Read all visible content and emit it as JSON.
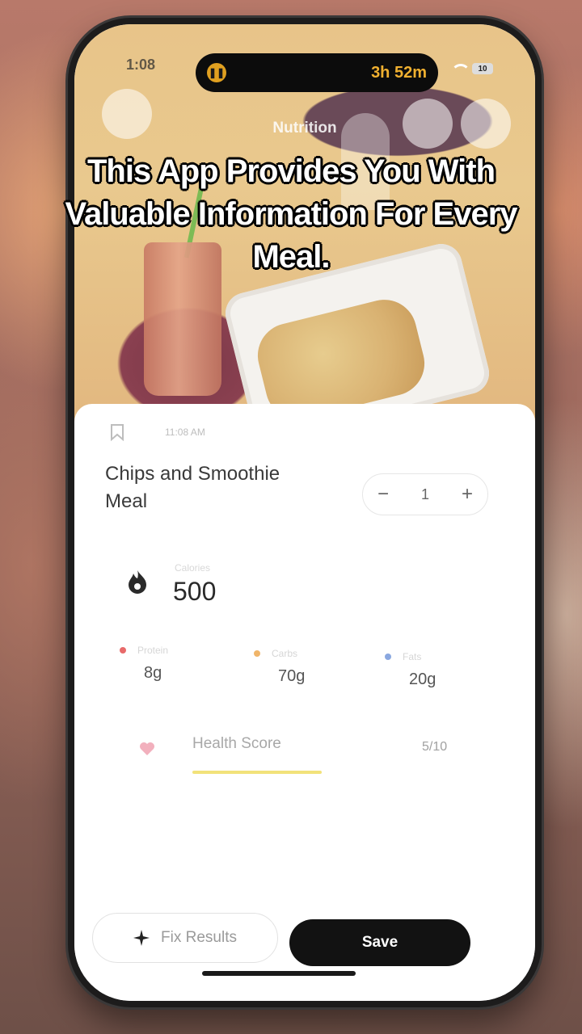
{
  "status_bar": {
    "time": "1:08",
    "island_timer": "3h 52m",
    "battery": "10"
  },
  "header": {
    "title": "Nutrition"
  },
  "caption": "This App Provides You With Valuable Information For Every Meal.",
  "meal": {
    "time": "11:08 AM",
    "name": "Chips and Smoothie Meal",
    "quantity": "1",
    "minus_label": "−",
    "plus_label": "+"
  },
  "calories": {
    "label": "Calories",
    "value": "500"
  },
  "macros": [
    {
      "label": "Protein",
      "value": "8g",
      "color": "#e86a6a"
    },
    {
      "label": "Carbs",
      "value": "70g",
      "color": "#f0b56a"
    },
    {
      "label": "Fats",
      "value": "20g",
      "color": "#8aa8e0"
    }
  ],
  "health_score": {
    "label": "Health Score",
    "value": "5/10",
    "level": 0.5,
    "bar_color": "#f2e27a"
  },
  "actions": {
    "fix_label": "Fix Results",
    "save_label": "Save"
  },
  "icons": {
    "bookmark": "bookmark-icon",
    "calories": "flame-icon",
    "health": "heart-icon",
    "fix": "sparkle-icon"
  }
}
